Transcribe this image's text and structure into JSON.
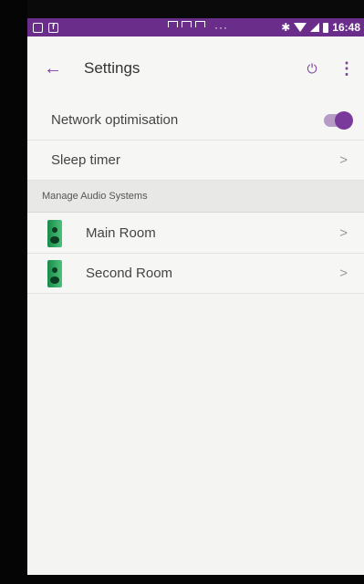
{
  "statusbar": {
    "time": "16:48",
    "more": "···"
  },
  "toolbar": {
    "back_label": "←",
    "title": "Settings",
    "power_label": "⏻",
    "more_label": "⋮"
  },
  "settings": {
    "network_optimisation": {
      "label": "Network optimisation",
      "enabled": true
    },
    "sleep_timer": {
      "label": "Sleep timer",
      "chevron": ">"
    }
  },
  "section": {
    "title": "Manage Audio Systems"
  },
  "systems": [
    {
      "label": "Main Room",
      "chevron": ">"
    },
    {
      "label": "Second Room",
      "chevron": ">"
    }
  ],
  "colors": {
    "accent": "#7a3a9c",
    "statusbar": "#6a2e8a"
  }
}
